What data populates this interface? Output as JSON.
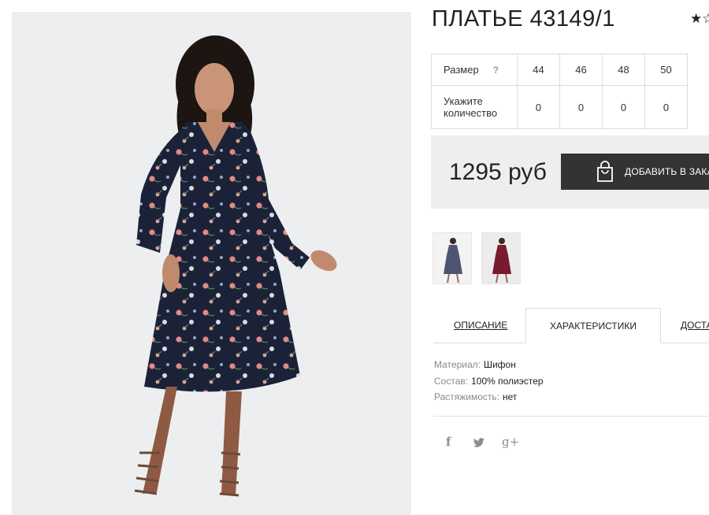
{
  "product": {
    "title": "ПЛАТЬЕ 43149/1",
    "rating_glyph": "★☆",
    "image_alt": "Платье 43149/1"
  },
  "sizes": {
    "label": "Размер",
    "help": "?",
    "values": [
      "44",
      "46",
      "48",
      "50"
    ],
    "qty_label": "Укажите количество",
    "quantities": [
      "0",
      "0",
      "0",
      "0"
    ]
  },
  "price": {
    "text": "1295 руб",
    "button_label": "ДОБАВИТЬ В ЗАКАЗ"
  },
  "tabs": [
    "ОПИСАНИЕ",
    "ХАРАКТЕРИСТИКИ",
    "ДОСТАВКА"
  ],
  "tabs_active": 1,
  "specs": [
    {
      "key": "Материал:",
      "value": "Шифон"
    },
    {
      "key": "Состав:",
      "value": "100% полиэстер"
    },
    {
      "key": "Растяжимость:",
      "value": "нет"
    }
  ],
  "social": {
    "facebook": "f",
    "twitter": "🐦",
    "googleplus": "g+"
  },
  "colors": {
    "dress_navy": "#1b2238",
    "dress_wine": "#7a1a2e",
    "button_dark": "#333333",
    "panel_gray": "#eeeeee"
  }
}
